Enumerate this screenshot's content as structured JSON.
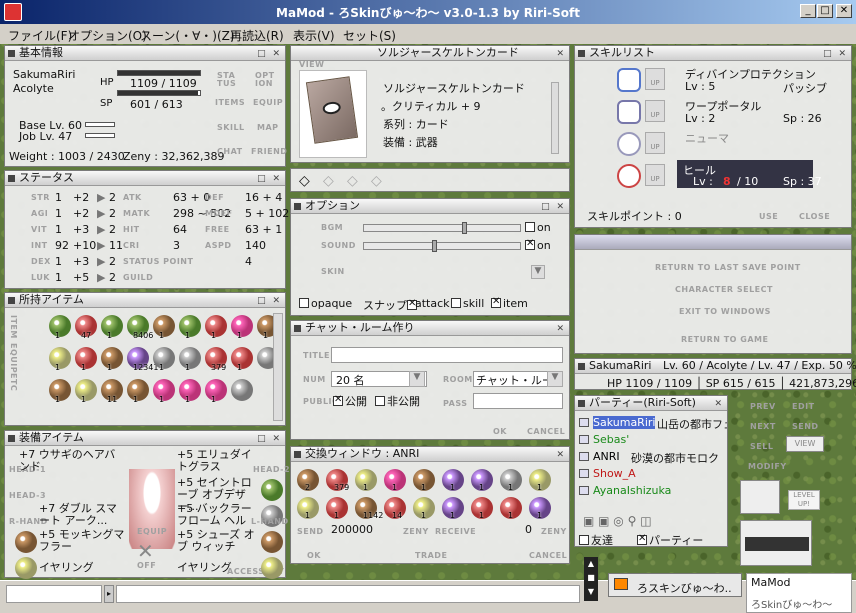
{
  "window": {
    "title": "MaMod - ろSkinびゅ～わ～ v3.0-1.3 by Riri-Soft",
    "min": "_",
    "max": "□",
    "close": "✕"
  },
  "menu": [
    "ファイル(F)",
    "オプション(O)",
    "スーン(・∀・)(Z)",
    "再読込(R)",
    "表示(V)",
    "セット(S)"
  ],
  "basic": {
    "title": "基本情報",
    "name": "SakumaRiri",
    "job": "Acolyte",
    "hp_label": "HP",
    "hp": "1109 / 1109",
    "hp_frac": 1.0,
    "sp_label": "SP",
    "sp": "601 / 613",
    "sp_frac": 0.98,
    "base_lv": "Base Lv. 60",
    "job_lv": "Job Lv. 47",
    "weight": "Weight : 1003 / 2430",
    "zeny": "Zeny : 32,362,389",
    "buttons": [
      "STA TUS",
      "OPT ION",
      "ITEMS",
      "EQUIP",
      "SKILL",
      "MAP",
      "CHAT",
      "FRIEND"
    ]
  },
  "status": {
    "title": "ステータス",
    "rows": [
      {
        "k": "STR",
        "a": "1",
        "b": "+2",
        "c": "2",
        "k2": "ATK",
        "v2": "63 + 0",
        "k3": "DEF",
        "v3": "16 + 4"
      },
      {
        "k": "AGI",
        "a": "1",
        "b": "+2",
        "c": "2",
        "k2": "MATK",
        "v2": "298 ~ 502",
        "k3": "MDEF",
        "v3": "5 + 102"
      },
      {
        "k": "VIT",
        "a": "1",
        "b": "+3",
        "c": "2",
        "k2": "HIT",
        "v2": "64",
        "k3": "FREE",
        "v3": "63 + 1"
      },
      {
        "k": "INT",
        "a": "92",
        "b": "+10",
        "c": "11",
        "k2": "CRI",
        "v2": "3",
        "k3": "ASPD",
        "v3": "140"
      },
      {
        "k": "DEX",
        "a": "1",
        "b": "+3",
        "c": "2",
        "k2": "STATUS POINT",
        "v2": "",
        "k3": "",
        "v3": "4"
      },
      {
        "k": "LUK",
        "a": "1",
        "b": "+5",
        "c": "2",
        "k2": "GUILD",
        "v2": "",
        "k3": "",
        "v3": ""
      }
    ]
  },
  "inventory": {
    "title": "所持アイテム",
    "tabs": [
      "ITEM",
      "EQUIP",
      "ETC"
    ],
    "counts": [
      "1",
      "47",
      "1",
      "8406",
      "1",
      "1",
      "1",
      "1",
      "1",
      "1",
      "1",
      "1",
      "12341",
      "1",
      "1",
      "379",
      "1",
      "",
      "1",
      "1",
      "11",
      "1",
      "1",
      "1",
      "1",
      ""
    ]
  },
  "equip": {
    "title": "装備アイテム",
    "left": [
      "+7 ウサギのヘアバンド",
      "+7 ダブル スマート アーク...",
      "+5 モッキングマフラー",
      "イヤリング"
    ],
    "right": [
      "+5 エリュダイトグラス",
      "+5 セイントローブ オブデザー...",
      "+5 バックラー フローム ヘル",
      "+5 シューズ オブ ウィッチ",
      "イヤリング"
    ],
    "slots": [
      "HEAD-1",
      "HEAD-2",
      "HEAD-3",
      "R-HAND",
      "L-HAND",
      "ROBE",
      "SHOES",
      "ACCESSORY",
      "ACCESSORY"
    ],
    "labels": [
      "EQUIP",
      "OFF"
    ]
  },
  "card": {
    "title": "ソルジャースケルトンカード",
    "view": "VIEW",
    "lines": [
      "ソルジャースケルトンカード",
      "。クリティカル + 9",
      "系列 : カード",
      "装備 : 武器"
    ]
  },
  "options": {
    "title": "オプション",
    "bgm": "BGM",
    "sound": "SOUND",
    "skin": "SKIN",
    "bgm_on": "on",
    "sound_on": "on",
    "bgm_level": 0.65,
    "sound_level": 0.45,
    "checks": [
      "opaque",
      "スナップ",
      "attack",
      "skill",
      "item"
    ]
  },
  "chat": {
    "title": "チャット・ルーム作り",
    "fields": {
      "title": "TITLE",
      "num": "NUM",
      "room": "ROOM",
      "public": "PUBLIC",
      "pass": "PASS"
    },
    "num_val": "20 名",
    "room_val": "チャット・ルー",
    "public_label": "公開",
    "private_label": "非公開",
    "ok": "OK",
    "cancel": "CANCEL"
  },
  "trade": {
    "title": "交換ウィンドウ : ANRI",
    "counts": [
      "2",
      "379",
      "1",
      "1",
      "1",
      "1",
      "1",
      "1",
      "1",
      "1",
      "1",
      "1142",
      "14",
      "1",
      "1",
      "1",
      "1",
      "1"
    ],
    "send_label": "SEND",
    "send_val": "200000",
    "zeny": "ZENY",
    "receive": "RECEIVE",
    "recv_val": "0",
    "ok": "OK",
    "trade": "TRADE",
    "cancel": "CANCEL"
  },
  "skills": {
    "title": "スキルリスト",
    "list": [
      {
        "name": "ディバインプロテクション",
        "lv": "Lv : 5",
        "extra": "パッシブ"
      },
      {
        "name": "ワープポータル",
        "lv": "Lv : 2",
        "extra": "Sp : 26"
      },
      {
        "name": "ニューマ",
        "lv": "",
        "extra": ""
      },
      {
        "name": "ヒール",
        "lv": "Lv :  ",
        "cur": "8",
        "max": "/ 10",
        "extra": "Sp : 37"
      }
    ],
    "points": "スキルポイント : 0",
    "use": "USE",
    "close": "CLOSE",
    "up": "UP"
  },
  "menu_panel": [
    "RETURN TO LAST SAVE POINT",
    "CHARACTER SELECT",
    "EXIT TO WINDOWS",
    "RETURN TO GAME"
  ],
  "charbar": {
    "name": "SakumaRiri",
    "info": "Lv. 60 / Acolyte / Lv. 47 / Exp. 50 %",
    "stats": "HP 1109 / 1109 │ SP 615 / 615 │ 421,873,296 Z"
  },
  "party": {
    "title": "パーティー(Riri-Soft)",
    "members": [
      {
        "name": "SakumaRiri",
        "map": "山岳の都市フェ",
        "color": "#1a3cc0"
      },
      {
        "name": "Sebas'",
        "map": "",
        "color": "#1a8a1a"
      },
      {
        "name": "ANRI",
        "map": "砂漠の都市モロク",
        "color": "#000"
      },
      {
        "name": "Show_A",
        "map": "",
        "color": "#c01818"
      },
      {
        "name": "AyanaIshizuka",
        "map": "",
        "color": "#1a8a1a"
      }
    ],
    "friend": "友達",
    "party": "パーティー"
  },
  "side_buttons": [
    "PREV",
    "EDIT",
    "NEXT",
    "SEND",
    "SELL",
    "VIEW",
    "MODIFY",
    "LEVEL UP!"
  ],
  "taskbar": {
    "label": "ろスキンびゅ～わ..",
    "mamod": "MaMod",
    "mamod_sub": "ろSkinびゅ～わ～"
  }
}
